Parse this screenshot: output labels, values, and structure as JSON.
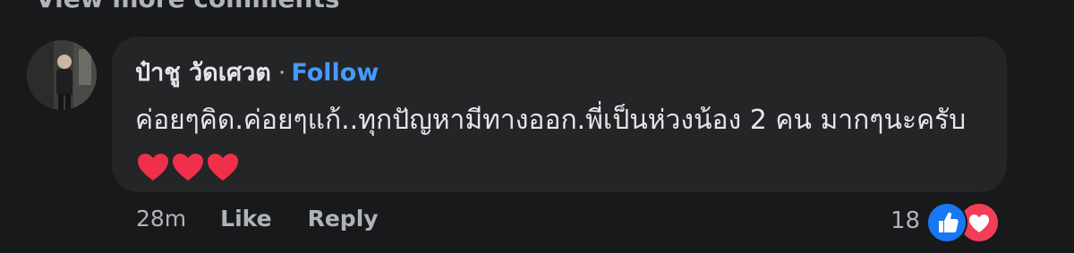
{
  "header": {
    "view_more_label": "View more comments"
  },
  "comment": {
    "author": "ป๋าชู วัดเศวต",
    "separator": "·",
    "follow_label": "Follow",
    "text": "ค่อยๆคิด.ค่อยๆแก้..ทุกปัญหามีทางออก.พี่เป็นห่วงน้อง 2 คน มากๆนะครับ",
    "emoji": [
      "red-heart",
      "red-heart",
      "red-heart"
    ],
    "timestamp": "28m",
    "like_label": "Like",
    "reply_label": "Reply",
    "reaction_count": "18",
    "reaction_types": [
      "like",
      "love"
    ]
  },
  "colors": {
    "background": "#18191a",
    "bubble": "#242526",
    "text_primary": "#e4e6eb",
    "text_secondary": "#b0b3b8",
    "follow_link": "#4599ff",
    "like_reaction": "#1877f2",
    "love_reaction": "#f33e58"
  }
}
